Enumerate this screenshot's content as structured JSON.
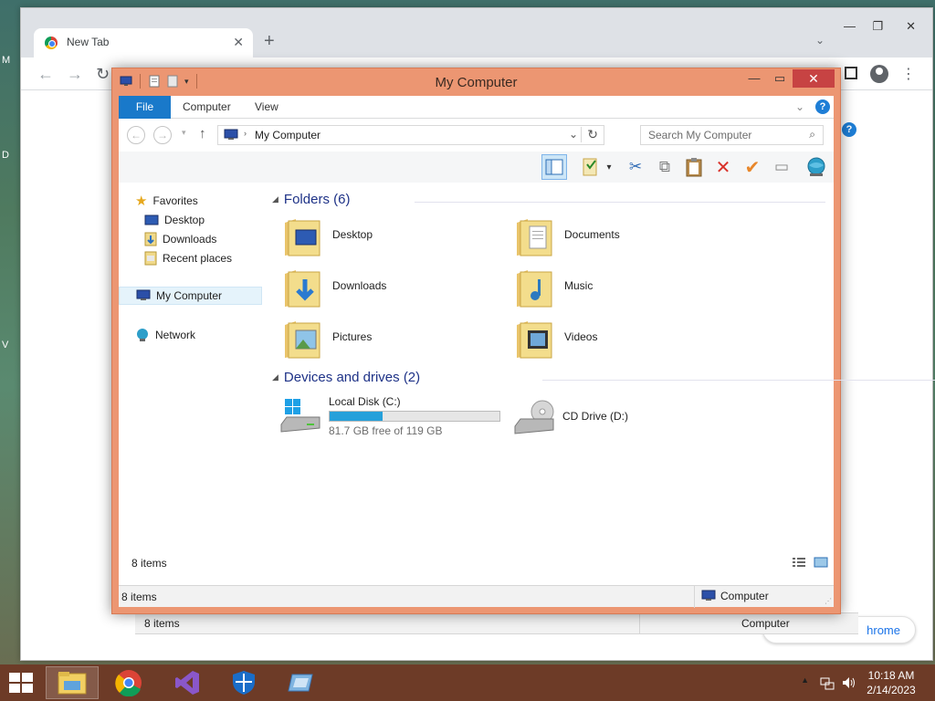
{
  "desktop": {
    "side_letters": [
      "M",
      "D",
      "V"
    ]
  },
  "chrome": {
    "tab_title": "New Tab",
    "tab_close": "✕",
    "new_tab": "+",
    "tab_dropdown": "⌄",
    "controls": [
      "—",
      "❐",
      "✕"
    ],
    "back": "←",
    "forward": "→",
    "reload": "↻",
    "menu": "⋮",
    "bottom_button_label": "hrome",
    "ghost_status_items": "8 items",
    "ghost_status_computer": "Computer",
    "ghost_help": "?"
  },
  "explorer": {
    "title": "My Computer",
    "window_controls": {
      "minimize": "—",
      "maximize": "▭",
      "close": "✕"
    },
    "ribbon_tabs": {
      "file": "File",
      "computer": "Computer",
      "view": "View"
    },
    "ribbon_expand": "⌄",
    "help": "?",
    "nav": {
      "back": "←",
      "forward": "→",
      "recent": "▾",
      "up": "↑"
    },
    "address": {
      "breadcrumb": "My Computer",
      "separator": "›",
      "dropdown": "⌄",
      "refresh": "↻"
    },
    "search": {
      "placeholder": "Search My Computer",
      "icon": "⌕"
    },
    "commands": [
      {
        "name": "preview-pane-icon",
        "glyph": ""
      },
      {
        "name": "properties-icon",
        "glyph": ""
      },
      {
        "name": "properties-dropdown-icon",
        "glyph": "▾"
      },
      {
        "name": "cut-icon",
        "glyph": "✂"
      },
      {
        "name": "copy-icon",
        "glyph": "⧉"
      },
      {
        "name": "paste-icon",
        "glyph": "📋"
      },
      {
        "name": "delete-icon",
        "glyph": "✕"
      },
      {
        "name": "check-icon",
        "glyph": "✔"
      },
      {
        "name": "rename-icon",
        "glyph": "▭"
      },
      {
        "name": "globe-icon",
        "glyph": ""
      }
    ],
    "nav_pane": {
      "favorites": "Favorites",
      "desktop": "Desktop",
      "downloads": "Downloads",
      "recent_places": "Recent places",
      "my_computer": "My Computer",
      "network": "Network"
    },
    "folders_header": "Folders (6)",
    "folders": [
      {
        "name": "Desktop",
        "overlay": "desktop"
      },
      {
        "name": "Documents",
        "overlay": "documents"
      },
      {
        "name": "Downloads",
        "overlay": "downloads"
      },
      {
        "name": "Music",
        "overlay": "music"
      },
      {
        "name": "Pictures",
        "overlay": "pictures"
      },
      {
        "name": "Videos",
        "overlay": "videos"
      }
    ],
    "devices_header": "Devices and drives (2)",
    "drives": [
      {
        "name": "Local Disk (C:)",
        "free": "81.7 GB free of 119 GB",
        "used_fraction": 0.313
      },
      {
        "name": "CD Drive (D:)"
      }
    ],
    "inner_status_count": "8 items",
    "status_count": "8 items",
    "status_zone": "Computer",
    "status_grip": "⋰"
  },
  "taskbar": {
    "apps": [
      "file-explorer",
      "chrome",
      "visual-studio",
      "defender",
      "remote-desktop"
    ],
    "tray_expand": "▲",
    "time": "10:18 AM",
    "date": "2/14/2023"
  }
}
